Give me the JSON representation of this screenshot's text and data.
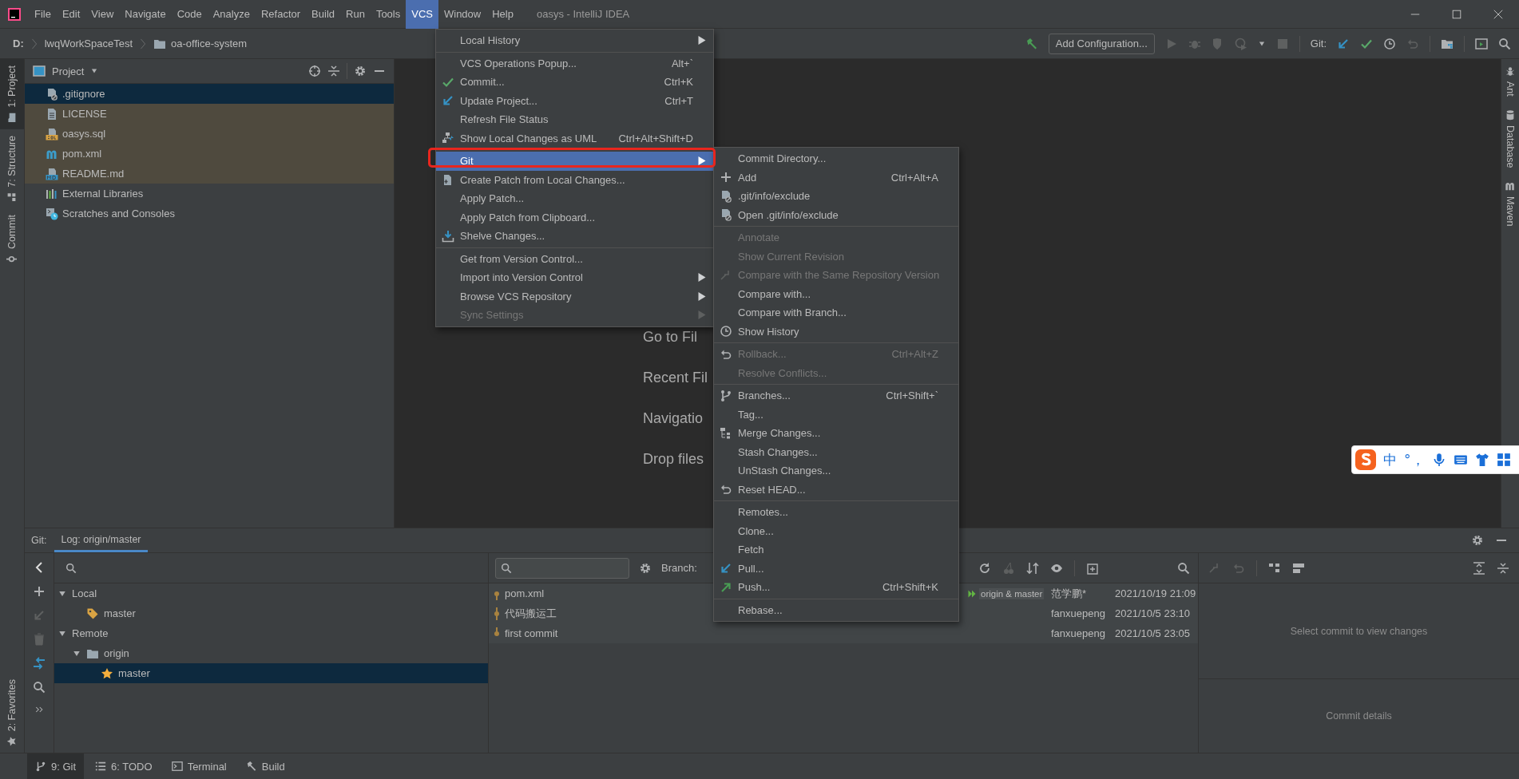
{
  "window": {
    "title": "oasys - IntelliJ IDEA"
  },
  "menu_bar": [
    {
      "label": "File",
      "selected": false
    },
    {
      "label": "Edit",
      "selected": false
    },
    {
      "label": "View",
      "selected": false
    },
    {
      "label": "Navigate",
      "selected": false
    },
    {
      "label": "Code",
      "selected": false
    },
    {
      "label": "Analyze",
      "selected": false
    },
    {
      "label": "Refactor",
      "selected": false
    },
    {
      "label": "Build",
      "selected": false
    },
    {
      "label": "Run",
      "selected": false
    },
    {
      "label": "Tools",
      "selected": false
    },
    {
      "label": "VCS",
      "selected": true
    },
    {
      "label": "Window",
      "selected": false
    },
    {
      "label": "Help",
      "selected": false
    }
  ],
  "nav_bar": {
    "breadcrumbs": [
      {
        "label": "D:",
        "kind": "drive"
      },
      {
        "label": "lwqWorkSpaceTest",
        "kind": "dir"
      },
      {
        "label": "oa-office-system",
        "kind": "folder"
      }
    ],
    "config_button": "Add Configuration...",
    "git_label": "Git:"
  },
  "left_stripe": {
    "top": [
      {
        "label": "1: Project",
        "selected": true,
        "kind": "project"
      },
      {
        "label": "7: Structure",
        "selected": false,
        "kind": "structure"
      },
      {
        "label": "Commit",
        "selected": false,
        "kind": "commit"
      }
    ],
    "bottom": [
      {
        "label": "2: Favorites",
        "selected": false,
        "kind": "favorites"
      }
    ]
  },
  "project_panel": {
    "title": "Project",
    "items": [
      {
        "label": ".gitignore",
        "kind": "ignore",
        "selected": true,
        "untracked": false
      },
      {
        "label": "LICENSE",
        "kind": "text",
        "selected": false,
        "untracked": true
      },
      {
        "label": "oasys.sql",
        "kind": "sql",
        "selected": false,
        "untracked": true
      },
      {
        "label": "pom.xml",
        "kind": "maven",
        "selected": false,
        "untracked": true
      },
      {
        "label": "README.md",
        "kind": "markdown",
        "selected": false,
        "untracked": true
      },
      {
        "label": "External Libraries",
        "kind": "libraries",
        "selected": false,
        "untracked": false
      },
      {
        "label": "Scratches and Consoles",
        "kind": "scratches",
        "selected": false,
        "untracked": false
      }
    ]
  },
  "editor": {
    "hints": [
      "Go to Fil",
      "Recent Fil",
      "Navigatio",
      "Drop files"
    ]
  },
  "right_stripe": [
    {
      "label": "Ant",
      "kind": "ant"
    },
    {
      "label": "Database",
      "kind": "database"
    },
    {
      "label": "Maven",
      "kind": "maven"
    }
  ],
  "vcs_menu": {
    "groups": [
      {
        "items": [
          {
            "label": "Local History",
            "kind": "plain",
            "submenu": true,
            "disabled": false,
            "selected": false
          }
        ]
      },
      {
        "items": [
          {
            "label": "VCS Operations Popup...",
            "shortcut": "Alt+`",
            "kind": "plain",
            "submenu": false,
            "disabled": false,
            "selected": false
          },
          {
            "label": "Commit...",
            "shortcut": "Ctrl+K",
            "kind": "commit",
            "submenu": false,
            "disabled": false,
            "selected": false
          },
          {
            "label": "Update Project...",
            "shortcut": "Ctrl+T",
            "kind": "update",
            "submenu": false,
            "disabled": false,
            "selected": false
          },
          {
            "label": "Refresh File Status",
            "kind": "plain",
            "submenu": false,
            "disabled": false,
            "selected": false
          },
          {
            "label": "Show Local Changes as UML",
            "shortcut": "Ctrl+Alt+Shift+D",
            "kind": "uml",
            "submenu": false,
            "disabled": false,
            "selected": false
          }
        ]
      },
      {
        "items": [
          {
            "label": "Git",
            "kind": "plain",
            "submenu": true,
            "disabled": false,
            "selected": true
          },
          {
            "label": "Create Patch from Local Changes...",
            "kind": "patch",
            "submenu": false,
            "disabled": false,
            "selected": false
          },
          {
            "label": "Apply Patch...",
            "kind": "plain",
            "submenu": false,
            "disabled": false,
            "selected": false
          },
          {
            "label": "Apply Patch from Clipboard...",
            "kind": "plain",
            "submenu": false,
            "disabled": false,
            "selected": false
          },
          {
            "label": "Shelve Changes...",
            "kind": "shelve",
            "submenu": false,
            "disabled": false,
            "selected": false
          }
        ]
      },
      {
        "items": [
          {
            "label": "Get from Version Control...",
            "kind": "plain",
            "submenu": false,
            "disabled": false,
            "selected": false
          },
          {
            "label": "Import into Version Control",
            "kind": "plain",
            "submenu": true,
            "disabled": false,
            "selected": false
          },
          {
            "label": "Browse VCS Repository",
            "kind": "plain",
            "submenu": true,
            "disabled": false,
            "selected": false
          },
          {
            "label": "Sync Settings",
            "kind": "plain",
            "submenu": true,
            "disabled": true,
            "selected": false
          }
        ]
      }
    ]
  },
  "git_submenu": {
    "groups": [
      {
        "items": [
          {
            "label": "Commit Directory...",
            "kind": "plain",
            "submenu": false,
            "disabled": false,
            "selected": false
          },
          {
            "label": "Add",
            "shortcut": "Ctrl+Alt+A",
            "kind": "add",
            "submenu": false,
            "disabled": false,
            "selected": false
          },
          {
            "label": ".git/info/exclude",
            "kind": "ignore",
            "submenu": false,
            "disabled": false,
            "selected": false
          },
          {
            "label": "Open .git/info/exclude",
            "kind": "ignore",
            "submenu": false,
            "disabled": false,
            "selected": false
          }
        ]
      },
      {
        "items": [
          {
            "label": "Annotate",
            "kind": "plain",
            "submenu": false,
            "disabled": true,
            "selected": false
          },
          {
            "label": "Show Current Revision",
            "kind": "plain",
            "submenu": false,
            "disabled": true,
            "selected": false
          },
          {
            "label": "Compare with the Same Repository Version",
            "kind": "compare",
            "submenu": false,
            "disabled": true,
            "selected": false
          },
          {
            "label": "Compare with...",
            "kind": "plain",
            "submenu": false,
            "disabled": false,
            "selected": false
          },
          {
            "label": "Compare with Branch...",
            "kind": "plain",
            "submenu": false,
            "disabled": false,
            "selected": false
          },
          {
            "label": "Show History",
            "kind": "history",
            "submenu": false,
            "disabled": false,
            "selected": false
          }
        ]
      },
      {
        "items": [
          {
            "label": "Rollback...",
            "shortcut": "Ctrl+Alt+Z",
            "kind": "rollback",
            "submenu": false,
            "disabled": true,
            "selected": false
          },
          {
            "label": "Resolve Conflicts...",
            "kind": "plain",
            "submenu": false,
            "disabled": true,
            "selected": false
          }
        ]
      },
      {
        "items": [
          {
            "label": "Branches...",
            "shortcut": "Ctrl+Shift+`",
            "kind": "branches",
            "submenu": false,
            "disabled": false,
            "selected": false
          },
          {
            "label": "Tag...",
            "kind": "plain",
            "submenu": false,
            "disabled": false,
            "selected": false
          },
          {
            "label": "Merge Changes...",
            "kind": "merge",
            "submenu": false,
            "disabled": false,
            "selected": false
          },
          {
            "label": "Stash Changes...",
            "kind": "plain",
            "submenu": false,
            "disabled": false,
            "selected": false
          },
          {
            "label": "UnStash Changes...",
            "kind": "plain",
            "submenu": false,
            "disabled": false,
            "selected": false
          },
          {
            "label": "Reset HEAD...",
            "kind": "rollback",
            "submenu": false,
            "disabled": false,
            "selected": false
          }
        ]
      },
      {
        "items": [
          {
            "label": "Remotes...",
            "kind": "plain",
            "submenu": false,
            "disabled": false,
            "selected": false
          },
          {
            "label": "Clone...",
            "kind": "plain",
            "submenu": false,
            "disabled": false,
            "selected": false
          },
          {
            "label": "Fetch",
            "kind": "plain",
            "submenu": false,
            "disabled": false,
            "selected": false
          },
          {
            "label": "Pull...",
            "kind": "update",
            "submenu": false,
            "disabled": false,
            "selected": false
          },
          {
            "label": "Push...",
            "shortcut": "Ctrl+Shift+K",
            "kind": "push",
            "submenu": false,
            "disabled": false,
            "selected": false
          }
        ]
      },
      {
        "items": [
          {
            "label": "Rebase...",
            "kind": "plain",
            "submenu": false,
            "disabled": false,
            "selected": false
          }
        ]
      }
    ]
  },
  "ime_bar": {
    "mode": "中",
    "punctuation": "°，"
  },
  "bottom_panel": {
    "title": "Git:",
    "tabs": [
      {
        "label": "Log: origin/master",
        "selected": true
      }
    ],
    "branches": [
      {
        "label": "Local",
        "expanded": true,
        "selected": false,
        "children": [
          {
            "label": "master",
            "kind": "tag",
            "selected": false
          }
        ]
      },
      {
        "label": "Remote",
        "expanded": true,
        "selected": false,
        "children": [
          {
            "label": "origin",
            "kind": "folder",
            "expanded": true,
            "selected": false,
            "children": [
              {
                "label": "master",
                "kind": "favorite",
                "selected": true
              }
            ]
          }
        ]
      }
    ],
    "log": {
      "branch_label": "Branch:",
      "commits": [
        {
          "subject": "pom.xml",
          "refs": "origin & master",
          "author": "范学鹏*",
          "date": "2021/10/19 21:09"
        },
        {
          "subject": "代码搬运工",
          "author": "fanxuepeng",
          "date": "2021/10/5 23:10"
        },
        {
          "subject": "first commit",
          "author": "fanxuepeng",
          "date": "2021/10/5 23:05"
        }
      ]
    },
    "changes_hint": "Select commit to view changes",
    "details_hint": "Commit details"
  },
  "status_bar": [
    {
      "label": "9: Git",
      "kind": "git",
      "selected": true
    },
    {
      "label": "6: TODO",
      "kind": "todo",
      "selected": false
    },
    {
      "label": "Terminal",
      "kind": "terminal",
      "selected": false
    },
    {
      "label": "Build",
      "kind": "build",
      "selected": false
    }
  ]
}
